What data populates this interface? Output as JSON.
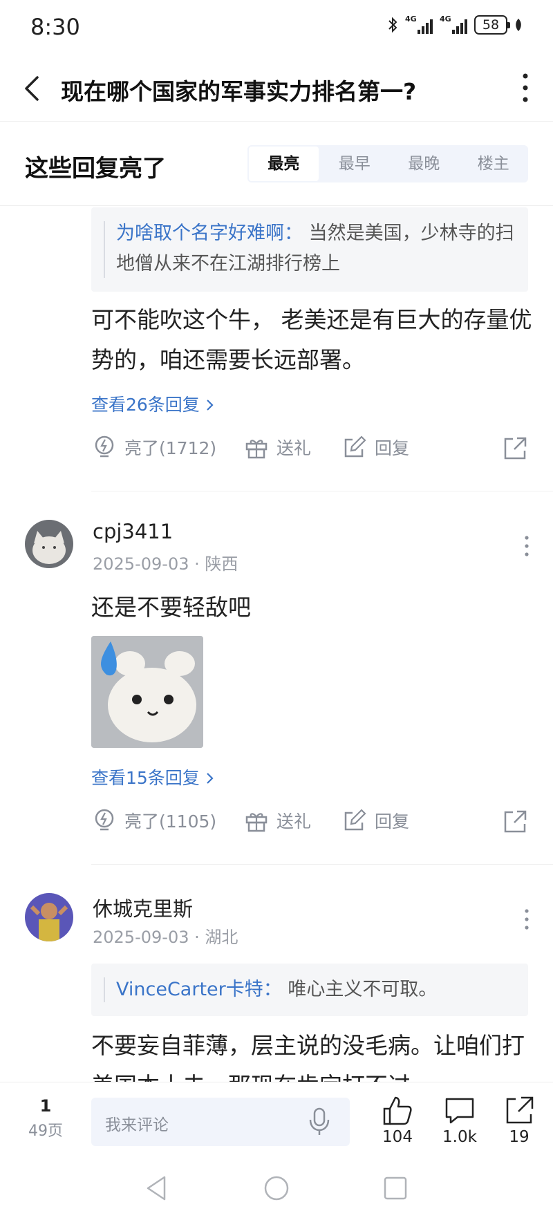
{
  "status": {
    "time": "8:30",
    "sig1": "4G",
    "sig2": "4G",
    "battery": "58"
  },
  "header": {
    "title": "现在哪个国家的军事实力排名第一?"
  },
  "section": {
    "title": "这些回复亮了",
    "tabs": [
      "最亮",
      "最早",
      "最晚",
      "楼主"
    ]
  },
  "comments": [
    {
      "quote_name": "为啥取个名字好难啊：",
      "quote_text": "当然是美国，少林寺的扫地僧从来不在江湖排行榜上",
      "text": "可不能吹这个牛， 老美还是有巨大的存量优势的，咱还需要长远部署。",
      "replies": "查看26条回复",
      "light": "亮了(1712)",
      "gift": "送礼",
      "reply": "回复"
    },
    {
      "user": "cpj3411",
      "date": "2025-09-03 · 陕西",
      "text": "还是不要轻敌吧",
      "replies": "查看15条回复",
      "light": "亮了(1105)",
      "gift": "送礼",
      "reply": "回复"
    },
    {
      "user": "休城克里斯",
      "date": "2025-09-03 · 湖北",
      "quote_name": "VinceCarter卡特：",
      "quote_text": "唯心主义不可取。",
      "text": "不要妄自菲薄，层主说的没毛病。让咱们打美国本土去，那现在肯定打不过"
    }
  ],
  "bottom": {
    "page": "1",
    "total_pages": "49页",
    "placeholder": "我来评论",
    "likes": "104",
    "comments": "1.0k",
    "shares": "19"
  },
  "colors": {
    "link": "#3a74c8",
    "muted": "#8a8f99",
    "tab_bg": "#f1f4fb"
  }
}
